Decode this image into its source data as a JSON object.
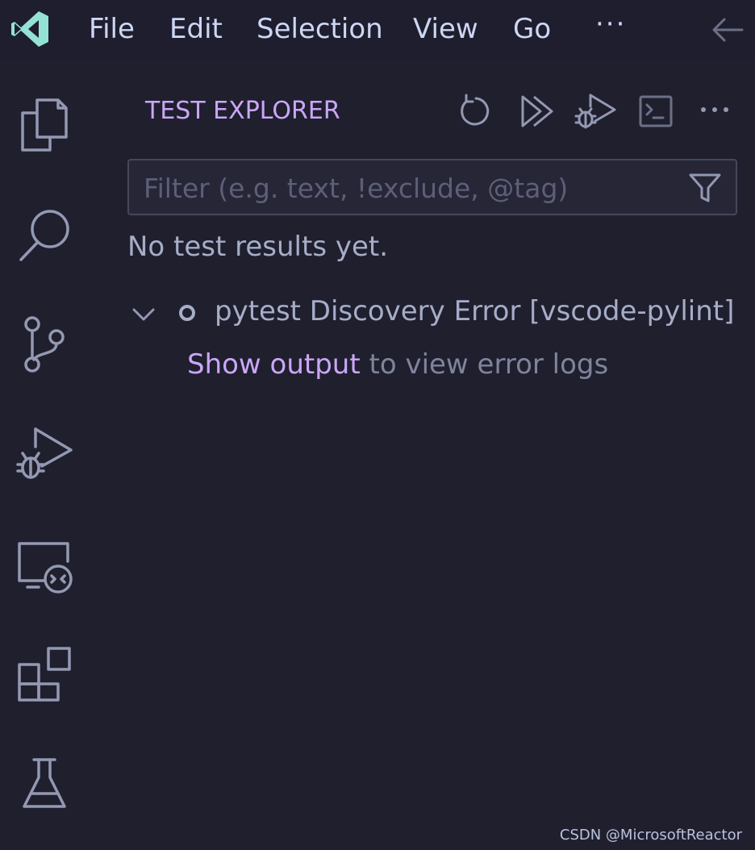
{
  "titlebar": {
    "menus": [
      "File",
      "Edit",
      "Selection",
      "View",
      "Go"
    ],
    "more": "···"
  },
  "activity_bar": {
    "icons": [
      "explorer-icon",
      "search-icon",
      "source-control-icon",
      "run-debug-icon",
      "remote-explorer-icon",
      "extensions-icon",
      "testing-icon"
    ]
  },
  "test_explorer": {
    "title": "TEST EXPLORER",
    "toolbar_icons": [
      "refresh-icon",
      "run-all-icon",
      "debug-all-icon",
      "terminal-output-icon",
      "more-icon"
    ],
    "filter": {
      "placeholder": "Filter (e.g. text, !exclude, @tag)",
      "value": ""
    },
    "status": "No test results yet.",
    "tree_item": {
      "label": "pytest Discovery Error [vscode-pylint]"
    },
    "output": {
      "link": "Show output",
      "rest": " to view error logs"
    }
  },
  "watermark": "CSDN @MicrosoftReactor",
  "colors": {
    "background": "#1f1f2e",
    "accent": "#cba6f7",
    "icon": "#9399b2",
    "text": "#cdd6f4"
  }
}
